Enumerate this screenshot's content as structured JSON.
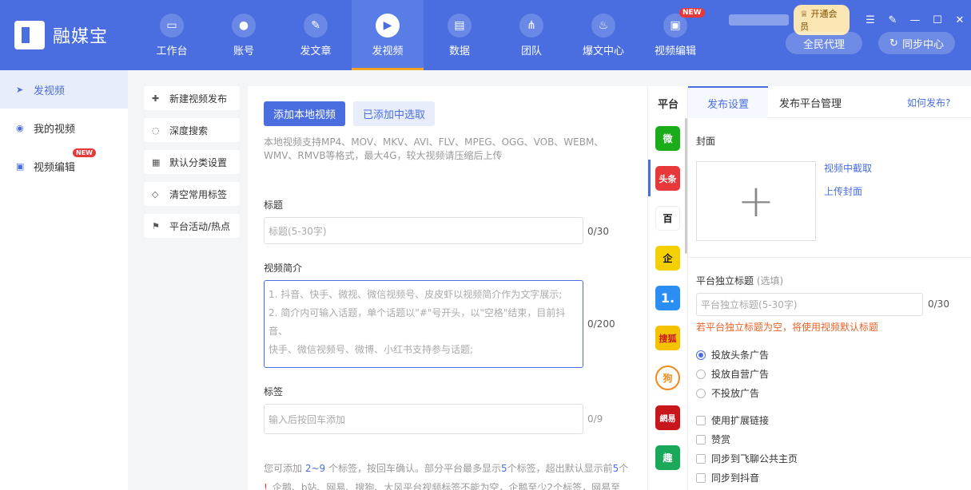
{
  "app": {
    "name": "融媒宝"
  },
  "nav": [
    {
      "label": "工作台",
      "icon": "▭",
      "name": "monitor-icon"
    },
    {
      "label": "账号",
      "icon": "●",
      "name": "user-icon"
    },
    {
      "label": "发文章",
      "icon": "✎",
      "name": "feather-icon"
    },
    {
      "label": "发视频",
      "icon": "▶",
      "name": "play-icon"
    },
    {
      "label": "数据",
      "icon": "▤",
      "name": "chart-icon"
    },
    {
      "label": "团队",
      "icon": "⋔",
      "name": "org-icon"
    },
    {
      "label": "爆文中心",
      "icon": "♨",
      "name": "flame-icon"
    },
    {
      "label": "视频编辑",
      "icon": "▣",
      "name": "toolbox-icon",
      "badge": "NEW"
    }
  ],
  "header": {
    "vip_label": "开通会员",
    "agent_label": "全民代理",
    "sync_label": "同步中心",
    "window_icons": [
      "☰",
      "✎",
      "—",
      "☐",
      "✕"
    ]
  },
  "left": {
    "items": [
      {
        "label": "发视频",
        "icon": "➤"
      },
      {
        "label": "我的视频",
        "icon": "◉"
      },
      {
        "label": "视频编辑",
        "icon": "▣",
        "badge": "NEW"
      }
    ]
  },
  "sub": {
    "items": [
      {
        "label": "新建视频发布",
        "icon": "✚"
      },
      {
        "label": "深度搜索",
        "icon": "◌"
      },
      {
        "label": "默认分类设置",
        "icon": "▦"
      },
      {
        "label": "清空常用标签",
        "icon": "◇"
      },
      {
        "label": "平台活动/热点",
        "icon": "⚑"
      }
    ]
  },
  "main": {
    "add_local_label": "添加本地视频",
    "add_existing_label": "已添加中选取",
    "format_hint": "本地视频支持MP4、MOV、MKV、AVI、FLV、MPEG、OGG、VOB、WEBM、WMV、RMVB等格式，最大4G，较大视频请压缩后上传",
    "title_label": "标题",
    "title_placeholder": "标题(5-30字)",
    "title_count": "0/30",
    "desc_label": "视频简介",
    "desc_line1": "1. 抖音、快手、微视、微信视频号、皮皮虾以视频简介作为文字展示;",
    "desc_line2": "2. 简介内可输入话题，单个话题以\"#\"号开头，以\"空格\"结束，目前抖音、",
    "desc_line3": "快手、微信视频号、微博、小红书支持参与话题;",
    "desc_count": "0/200",
    "tag_label": "标签",
    "tag_placeholder": "输入后按回车添加",
    "tag_count": "0/9",
    "tag_hint_pre": "您可添加 ",
    "tag_hint_range": "2~9",
    "tag_hint_mid": " 个标签，按回车确认。部分平台最多显示",
    "tag_hint_five": "5",
    "tag_hint_post": "个标签，超出默认显示前",
    "tag_hint_five2": "5",
    "tag_hint_end": "个",
    "warn_icon": "!",
    "warn_text": "企鹅、b站、网易、搜狗、大风平台视频标签不能为空，企鹅至少2个标签，网易至"
  },
  "platforms": {
    "title": "平台",
    "items": [
      {
        "label": "微",
        "name": "wechat-icon",
        "color": "#1aad19"
      },
      {
        "label": "头条",
        "name": "toutiao-icon",
        "color": "#e8393a"
      },
      {
        "label": "百",
        "name": "baijia-icon",
        "color": "#ffffff"
      },
      {
        "label": "企",
        "name": "qie-icon",
        "color": "#f5d000"
      },
      {
        "label": "1.",
        "name": "yidian-icon",
        "color": "#2b8ef5"
      },
      {
        "label": "搜狐",
        "name": "sohu-icon",
        "color": "#f5c200"
      },
      {
        "label": "狗",
        "name": "sogou-icon",
        "color": "#f08a1c"
      },
      {
        "label": "網易",
        "name": "netease-icon",
        "color": "#c8161d"
      },
      {
        "label": "趣",
        "name": "qutoutiao-icon",
        "color": "#1aa85a"
      }
    ]
  },
  "right": {
    "tab_publish": "发布设置",
    "tab_manage": "发布平台管理",
    "how_label": "如何发布?",
    "cover_label": "封面",
    "cover_plus": "+",
    "cover_from_video": "视频中截取",
    "cover_upload": "上传封面",
    "indep_title_label": "平台独立标题",
    "indep_title_optional": "(选填)",
    "indep_title_placeholder": "平台独立标题(5-30字)",
    "indep_title_count": "0/30",
    "indep_title_warn": "若平台独立标题为空，将使用视频默认标题",
    "radios": [
      "投放头条广告",
      "投放自营广告",
      "不投放广告"
    ],
    "checks": [
      "使用扩展链接",
      "赞赏",
      "同步到飞聊公共主页",
      "同步到抖音"
    ]
  }
}
